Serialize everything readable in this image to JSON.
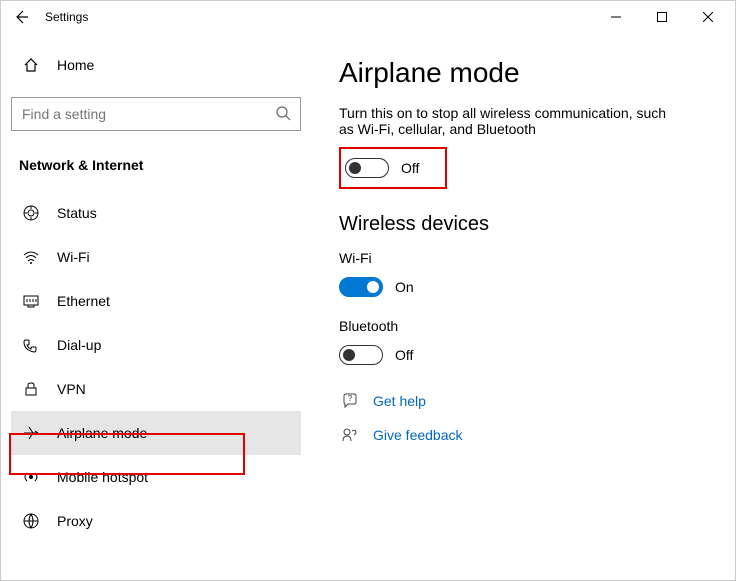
{
  "window": {
    "title": "Settings"
  },
  "sidebar": {
    "home_label": "Home",
    "search_placeholder": "Find a setting",
    "category": "Network & Internet",
    "items": [
      {
        "label": "Status"
      },
      {
        "label": "Wi-Fi"
      },
      {
        "label": "Ethernet"
      },
      {
        "label": "Dial-up"
      },
      {
        "label": "VPN"
      },
      {
        "label": "Airplane mode"
      },
      {
        "label": "Mobile hotspot"
      },
      {
        "label": "Proxy"
      }
    ]
  },
  "main": {
    "title": "Airplane mode",
    "description": "Turn this on to stop all wireless communication, such as Wi-Fi, cellular, and Bluetooth",
    "airplane_state": "Off",
    "subheading": "Wireless devices",
    "wifi_label": "Wi-Fi",
    "wifi_state": "On",
    "bt_label": "Bluetooth",
    "bt_state": "Off",
    "help_label": "Get help",
    "feedback_label": "Give feedback"
  }
}
